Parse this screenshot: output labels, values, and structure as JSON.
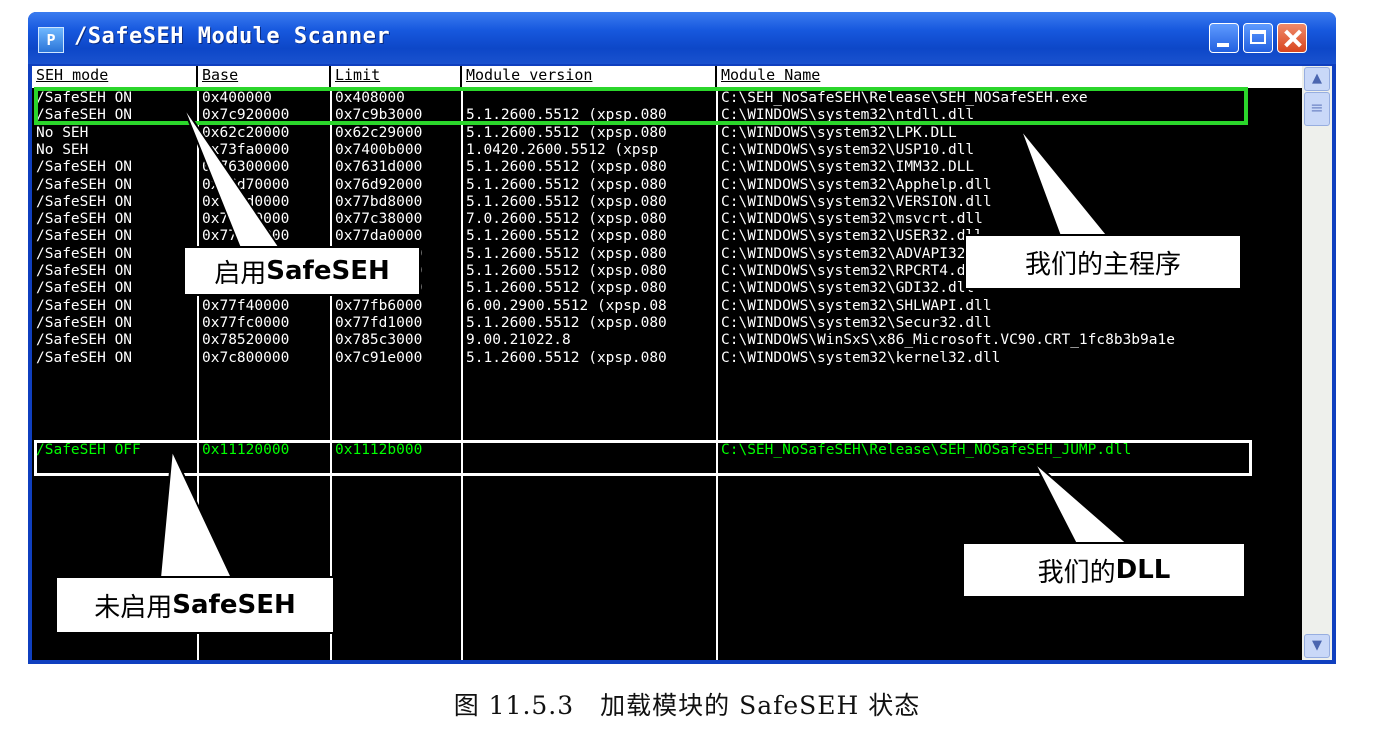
{
  "window": {
    "title": "/SafeSEH Module Scanner",
    "icon_letter": "P"
  },
  "columns": [
    "SEH mode",
    "Base",
    "Limit",
    "Module version",
    "Module Name"
  ],
  "rows": [
    {
      "mode": "/SafeSEH ON",
      "base": "0x400000",
      "limit": "0x408000",
      "version": "",
      "name": "C:\\SEH_NoSafeSEH\\Release\\SEH_NOSafeSEH.exe"
    },
    {
      "mode": "/SafeSEH ON",
      "base": "0x7c920000",
      "limit": "0x7c9b3000",
      "version": "5.1.2600.5512 (xpsp.080",
      "name": "C:\\WINDOWS\\system32\\ntdll.dll"
    },
    {
      "mode": "No SEH",
      "base": "0x62c20000",
      "limit": "0x62c29000",
      "version": "5.1.2600.5512 (xpsp.080",
      "name": "C:\\WINDOWS\\system32\\LPK.DLL"
    },
    {
      "mode": "No SEH",
      "base": "0x73fa0000",
      "limit": "0x7400b000",
      "version": "1.0420.2600.5512 (xpsp",
      "name": "C:\\WINDOWS\\system32\\USP10.dll"
    },
    {
      "mode": "/SafeSEH ON",
      "base": "0x76300000",
      "limit": "0x7631d000",
      "version": "5.1.2600.5512 (xpsp.080",
      "name": "C:\\WINDOWS\\system32\\IMM32.DLL"
    },
    {
      "mode": "/SafeSEH ON",
      "base": "0x76d70000",
      "limit": "0x76d92000",
      "version": "5.1.2600.5512 (xpsp.080",
      "name": "C:\\WINDOWS\\system32\\Apphelp.dll"
    },
    {
      "mode": "/SafeSEH ON",
      "base": "0x77bd0000",
      "limit": "0x77bd8000",
      "version": "5.1.2600.5512 (xpsp.080",
      "name": "C:\\WINDOWS\\system32\\VERSION.dll"
    },
    {
      "mode": "/SafeSEH ON",
      "base": "0x77be0000",
      "limit": "0x77c38000",
      "version": "7.0.2600.5512 (xpsp.080",
      "name": "C:\\WINDOWS\\system32\\msvcrt.dll"
    },
    {
      "mode": "/SafeSEH ON",
      "base": "0x77d10000",
      "limit": "0x77da0000",
      "version": "5.1.2600.5512 (xpsp.080",
      "name": "C:\\WINDOWS\\system32\\USER32.dll"
    },
    {
      "mode": "/SafeSEH ON",
      "base": "0x77da0000",
      "limit": "0x77e49000",
      "version": "5.1.2600.5512 (xpsp.080",
      "name": "C:\\WINDOWS\\system32\\ADVAPI32.dll"
    },
    {
      "mode": "/SafeSEH ON",
      "base": "0x77e50000",
      "limit": "0x77ee2000",
      "version": "5.1.2600.5512 (xpsp.080",
      "name": "C:\\WINDOWS\\system32\\RPCRT4.dll"
    },
    {
      "mode": "/SafeSEH ON",
      "base": "0x77ef0000",
      "limit": "0x77f39000",
      "version": "5.1.2600.5512 (xpsp.080",
      "name": "C:\\WINDOWS\\system32\\GDI32.dll"
    },
    {
      "mode": "/SafeSEH ON",
      "base": "0x77f40000",
      "limit": "0x77fb6000",
      "version": "6.00.2900.5512 (xpsp.08",
      "name": "C:\\WINDOWS\\system32\\SHLWAPI.dll"
    },
    {
      "mode": "/SafeSEH ON",
      "base": "0x77fc0000",
      "limit": "0x77fd1000",
      "version": "5.1.2600.5512 (xpsp.080",
      "name": "C:\\WINDOWS\\system32\\Secur32.dll"
    },
    {
      "mode": "/SafeSEH ON",
      "base": "0x78520000",
      "limit": "0x785c3000",
      "version": "9.00.21022.8",
      "name": "C:\\WINDOWS\\WinSxS\\x86_Microsoft.VC90.CRT_1fc8b3b9a1e"
    },
    {
      "mode": "/SafeSEH ON",
      "base": "0x7c800000",
      "limit": "0x7c91e000",
      "version": "5.1.2600.5512 (xpsp.080",
      "name": "C:\\WINDOWS\\system32\\kernel32.dll"
    },
    {
      "mode": "/SafeSEH OFF",
      "base": "0x11120000",
      "limit": "0x1112b000",
      "version": "",
      "name": "C:\\SEH_NoSafeSEH\\Release\\SEH_NOSafeSEH_JUMP.dll"
    }
  ],
  "callouts": {
    "safeseh_on_prefix": "启用",
    "safeseh_on_bold": "SafeSEH",
    "main_program": "我们的主程序",
    "safeseh_off_prefix": "未启用",
    "safeseh_off_bold": "SafeSEH",
    "our_dll_prefix": "我们的",
    "our_dll_bold": "DLL"
  },
  "caption": "图 11.5.3　加载模块的 SafeSEH 状态",
  "colors": {
    "selected_text": "#00ff00",
    "highlight_green": "#2bd62b",
    "title_blue": "#0d47c8"
  }
}
